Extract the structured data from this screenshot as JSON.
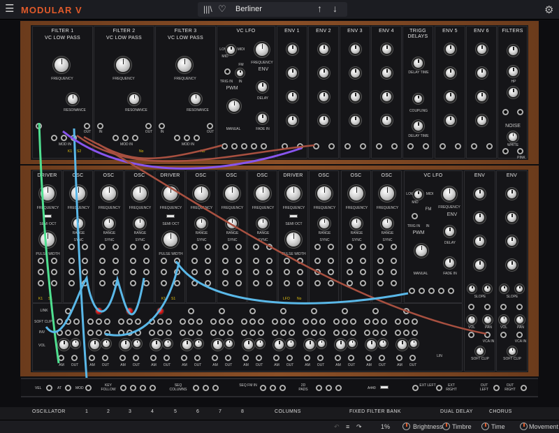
{
  "app": {
    "brand": "MODULAR V",
    "preset": "Berliner",
    "accent": "#e05a2a"
  },
  "icons": {
    "menu": "hamburger-icon",
    "library": "library-icon",
    "favorite": "heart-icon",
    "prev": "arrow-up-icon",
    "next": "arrow-down-icon",
    "settings": "gear-icon"
  },
  "upper": {
    "filter1": {
      "title": "FILTER 1",
      "sub": "VC LOW PASS",
      "freq": "FREQUENCY",
      "res": "RESONANCE",
      "in": "IN",
      "out": "OUT",
      "modin": "MOD IN",
      "k1": "K1",
      "s2": "S2"
    },
    "filter2": {
      "title": "FILTER 2",
      "sub": "VC LOW PASS",
      "freq": "FREQUENCY",
      "res": "RESONANCE",
      "in": "IN",
      "out": "OUT",
      "modin": "MOD IN",
      "no": "No"
    },
    "filter3": {
      "title": "FILTER 3",
      "sub": "VC LOW PASS",
      "freq": "FREQUENCY",
      "res": "RESONANCE",
      "in": "IN",
      "out": "OUT",
      "modin": "MOD IN",
      "no": "No"
    },
    "vclfo": {
      "title": "VC LFO",
      "low": "LOW",
      "mid": "MID",
      "midi": "MIDI",
      "freq": "FREQUENCY",
      "fm": "FM",
      "trig": "TRIG IN",
      "in": "IN",
      "pwm": "PWM",
      "env": "ENV",
      "delay": "DELAY",
      "manual": "MANUAL",
      "fadein": "FADE IN"
    },
    "env1": {
      "title": "ENV 1"
    },
    "env2": {
      "title": "ENV 2"
    },
    "env3": {
      "title": "ENV 3"
    },
    "env4": {
      "title": "ENV 4"
    },
    "trigg": {
      "title": "TRIGG DELAYS",
      "delay": "DELAY TIME",
      "coupling": "COUPLING",
      "delay2": "DELAY TIME"
    },
    "env5": {
      "title": "ENV 5"
    },
    "env6": {
      "title": "ENV 6"
    },
    "filters": {
      "title": "FILTERS",
      "hp": "HP",
      "noise": "NOISE",
      "white": "WHITE",
      "pink": "PINK"
    }
  },
  "lower": {
    "modules": [
      {
        "title": "DRIVER",
        "freq": "FREQUENCY",
        "sub": "SEMI OCT",
        "pw": "PULSE WIDTH"
      },
      {
        "title": "OSC",
        "freq": "FREQUENCY",
        "sub": "RANGE",
        "sync": "SYNC"
      },
      {
        "title": "OSC",
        "freq": "FREQUENCY",
        "sub": "RANGE",
        "sync": "SYNC"
      },
      {
        "title": "OSC",
        "freq": "FREQUENCY",
        "sub": "RANGE",
        "sync": "SYNC"
      },
      {
        "title": "DRIVER",
        "freq": "FREQUENCY",
        "sub": "SEMI OCT",
        "pw": "PULSE WIDTH"
      },
      {
        "title": "OSC",
        "freq": "FREQUENCY",
        "sub": "RANGE",
        "sync": "SYNC"
      },
      {
        "title": "OSC",
        "freq": "FREQUENCY",
        "sub": "RANGE",
        "sync": "SYNC"
      },
      {
        "title": "OSC",
        "freq": "FREQUENCY",
        "sub": "RANGE",
        "sync": "SYNC"
      },
      {
        "title": "DRIVER",
        "freq": "FREQUENCY",
        "sub": "SEMI OCT",
        "pw": "PULSE WIDTH"
      },
      {
        "title": "OSC",
        "freq": "FREQUENCY",
        "sub": "RANGE",
        "sync": "SYNC"
      },
      {
        "title": "OSC",
        "freq": "FREQUENCY",
        "sub": "RANGE",
        "sync": "SYNC"
      },
      {
        "title": "OSC",
        "freq": "FREQUENCY",
        "sub": "RANGE",
        "sync": "SYNC"
      }
    ],
    "vclfo": {
      "title": "VC LFO",
      "low": "LOW",
      "mid": "MID",
      "midi": "MIDI",
      "freq": "FREQUENCY",
      "fm": "FM",
      "trig": "TRIG IN",
      "in": "IN",
      "env": "ENV",
      "pwm": "PWM",
      "delay": "DELAY",
      "manual": "MANUAL",
      "fadein": "FADE IN"
    },
    "env_a": {
      "title": "ENV",
      "slope": "SLOPE",
      "vol": "VOL",
      "pan": "PAN",
      "vcain": "VCA IN",
      "softclip": "SOFT CLIP"
    },
    "env_b": {
      "title": "ENV",
      "slope": "SLOPE",
      "vol": "VOL",
      "pan": "PAN",
      "vcain": "VCA IN",
      "softclip": "SOFT CLIP"
    },
    "mixer": {
      "link": "LINK",
      "softclip": "SOFT CLIP",
      "inv": "INV",
      "vol": "VOL",
      "am": "AM",
      "out": "OUT",
      "lin": "LIN"
    },
    "tags": {
      "k1": "K1",
      "s1": "S1",
      "lfo": "LFO",
      "no": "No"
    }
  },
  "rail": {
    "vel": "VEL",
    "at": "AT",
    "mod": "MOD",
    "keyfollow": "KEY FOLLOW",
    "seqcol": "SEQ COLUMNS",
    "seqfm": "SEQ FM IN",
    "pads": "2D PADS",
    "a440": "A440",
    "extleft": "EXT LEFT",
    "extright": "EXT RIGHT",
    "outleft": "OUT LEFT",
    "outright": "OUT RIGHT"
  },
  "tabs": {
    "oscillator": "OSCILLATOR",
    "nums": [
      "1",
      "2",
      "3",
      "4",
      "5",
      "6",
      "7",
      "8"
    ],
    "columns": "COLUMNS",
    "fixed": "FIXED FILTER BANK",
    "dual": "DUAL DELAY",
    "chorus": "CHORUS"
  },
  "status": {
    "zoom": "1%",
    "brightness": "Brightness",
    "timbre": "Timbre",
    "time": "Time",
    "movement": "Movement"
  }
}
